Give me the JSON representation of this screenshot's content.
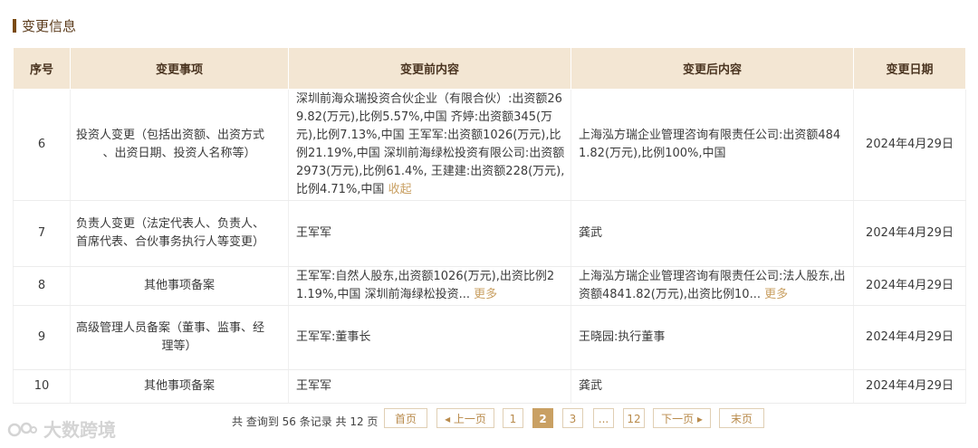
{
  "section": {
    "title": "变更信息"
  },
  "table": {
    "headers": [
      "序号",
      "变更事项",
      "变更前内容",
      "变更后内容",
      "变更日期"
    ],
    "rows": [
      {
        "no": "6",
        "item_line1": "投资人变更（包括出资额、出资方式",
        "item_line2": "、出资日期、投资人名称等）",
        "before": "深圳前海众瑞投资合伙企业（有限合伙）:出资额269.82(万元),比例5.57%,中国 齐婷:出资额345(万元),比例7.13%,中国 王军军:出资额1026(万元),比例21.19%,中国 深圳前海绿松投资有限公司:出资额2973(万元),比例61.4%, 王建建:出资额228(万元),比例4.71%,中国",
        "before_link": "收起",
        "after": "上海泓方瑞企业管理咨询有限责任公司:出资额4841.82(万元),比例100%,中国",
        "after_link": "",
        "date": "2024年4月29日"
      },
      {
        "no": "7",
        "item_line1": "负责人变更（法定代表人、负责人、",
        "item_line2": "首席代表、合伙事务执行人等变更）",
        "before": "王军军",
        "before_link": "",
        "after": "龚武",
        "after_link": "",
        "date": "2024年4月29日"
      },
      {
        "no": "8",
        "item_line1": "其他事项备案",
        "item_line2": "",
        "before": "王军军:自然人股东,出资额1026(万元),出资比例21.19%,中国 深圳前海绿松投资...",
        "before_link": "更多",
        "after": "上海泓方瑞企业管理咨询有限责任公司:法人股东,出资额4841.82(万元),出资比例10...",
        "after_link": "更多",
        "date": "2024年4月29日"
      },
      {
        "no": "9",
        "item_line1": "高级管理人员备案（董事、监事、经",
        "item_line2": "理等）",
        "before": "王军军:董事长",
        "before_link": "",
        "after": "王晓园:执行董事",
        "after_link": "",
        "date": "2024年4月29日"
      },
      {
        "no": "10",
        "item_line1": "其他事项备案",
        "item_line2": "",
        "before": "王军军",
        "before_link": "",
        "after": "龚武",
        "after_link": "",
        "date": "2024年4月29日"
      }
    ]
  },
  "pagination": {
    "summary": "共 查询到 56 条记录 共 12 页",
    "first": "首页",
    "prev": "◂ 上一页",
    "pages": [
      "1",
      "2",
      "3",
      "...",
      "12"
    ],
    "current": "2",
    "next": "下一页 ▸",
    "last": "末页"
  },
  "watermark": {
    "text": "大数跨境"
  },
  "colors": {
    "header_bg": "#f3e6d3",
    "accent": "#c9a063",
    "title_bar": "#7a4a12"
  }
}
